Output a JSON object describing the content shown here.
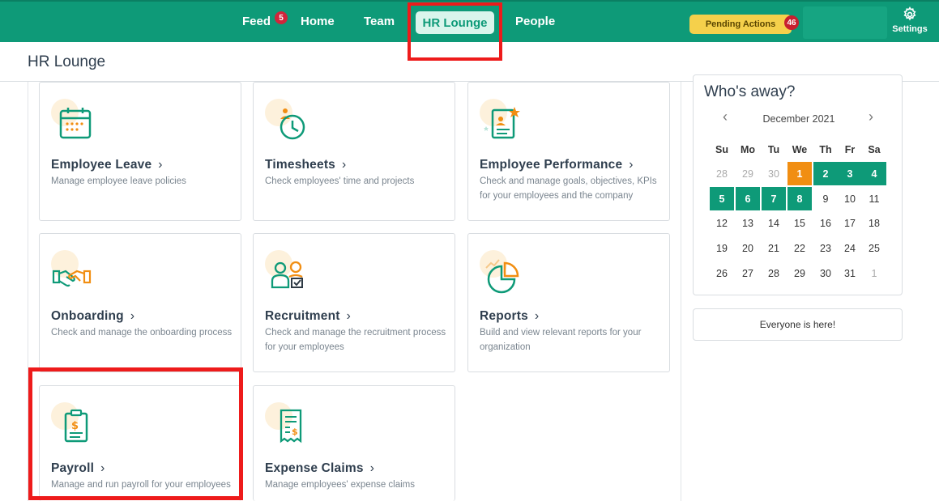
{
  "nav": {
    "feed": "Feed",
    "feed_badge": "5",
    "home": "Home",
    "team": "Team",
    "hr_lounge": "HR Lounge",
    "people": "People",
    "pending_actions": "Pending Actions",
    "pending_badge": "46",
    "settings": "Settings"
  },
  "page": {
    "title": "HR Lounge"
  },
  "cards": [
    {
      "title": "Employee Leave",
      "desc": "Manage employee leave policies",
      "icon": "calendar-icon"
    },
    {
      "title": "Timesheets",
      "desc": "Check employees' time and projects",
      "icon": "clock-person-icon"
    },
    {
      "title": "Employee Performance",
      "desc": "Check and manage goals, objectives, KPIs for your employees and the company",
      "icon": "performance-star-icon"
    },
    {
      "title": "Onboarding",
      "desc": "Check and manage the onboarding process",
      "icon": "handshake-icon"
    },
    {
      "title": "Recruitment",
      "desc": "Check and manage the recruitment process for your employees",
      "icon": "recruitment-people-icon"
    },
    {
      "title": "Reports",
      "desc": "Build and view relevant reports for your organization",
      "icon": "pie-chart-icon"
    },
    {
      "title": "Payroll",
      "desc": "Manage and run payroll for your employees",
      "icon": "payroll-document-icon"
    },
    {
      "title": "Expense Claims",
      "desc": "Manage employees' expense claims",
      "icon": "receipt-icon"
    }
  ],
  "calendar": {
    "title": "Who's away?",
    "month": "December 2021",
    "weekdays": [
      "Su",
      "Mo",
      "Tu",
      "We",
      "Th",
      "Fr",
      "Sa"
    ],
    "weeks": [
      [
        {
          "d": "28",
          "s": "other"
        },
        {
          "d": "29",
          "s": "other"
        },
        {
          "d": "30",
          "s": "other"
        },
        {
          "d": "1",
          "s": "today"
        },
        {
          "d": "2",
          "s": "away"
        },
        {
          "d": "3",
          "s": "away"
        },
        {
          "d": "4",
          "s": "away"
        }
      ],
      [
        {
          "d": "5",
          "s": "away"
        },
        {
          "d": "6",
          "s": "away"
        },
        {
          "d": "7",
          "s": "away"
        },
        {
          "d": "8",
          "s": "away"
        },
        {
          "d": "9",
          "s": ""
        },
        {
          "d": "10",
          "s": ""
        },
        {
          "d": "11",
          "s": ""
        }
      ],
      [
        {
          "d": "12",
          "s": ""
        },
        {
          "d": "13",
          "s": ""
        },
        {
          "d": "14",
          "s": ""
        },
        {
          "d": "15",
          "s": ""
        },
        {
          "d": "16",
          "s": ""
        },
        {
          "d": "17",
          "s": ""
        },
        {
          "d": "18",
          "s": ""
        }
      ],
      [
        {
          "d": "19",
          "s": ""
        },
        {
          "d": "20",
          "s": ""
        },
        {
          "d": "21",
          "s": ""
        },
        {
          "d": "22",
          "s": ""
        },
        {
          "d": "23",
          "s": ""
        },
        {
          "d": "24",
          "s": ""
        },
        {
          "d": "25",
          "s": ""
        }
      ],
      [
        {
          "d": "26",
          "s": ""
        },
        {
          "d": "27",
          "s": ""
        },
        {
          "d": "28",
          "s": ""
        },
        {
          "d": "29",
          "s": ""
        },
        {
          "d": "30",
          "s": ""
        },
        {
          "d": "31",
          "s": ""
        },
        {
          "d": "1",
          "s": "other"
        }
      ]
    ]
  },
  "everyone": "Everyone is here!",
  "colors": {
    "brand": "#0e9a78",
    "accent_orange": "#f18e12",
    "highlight": "#ee1b1b"
  }
}
